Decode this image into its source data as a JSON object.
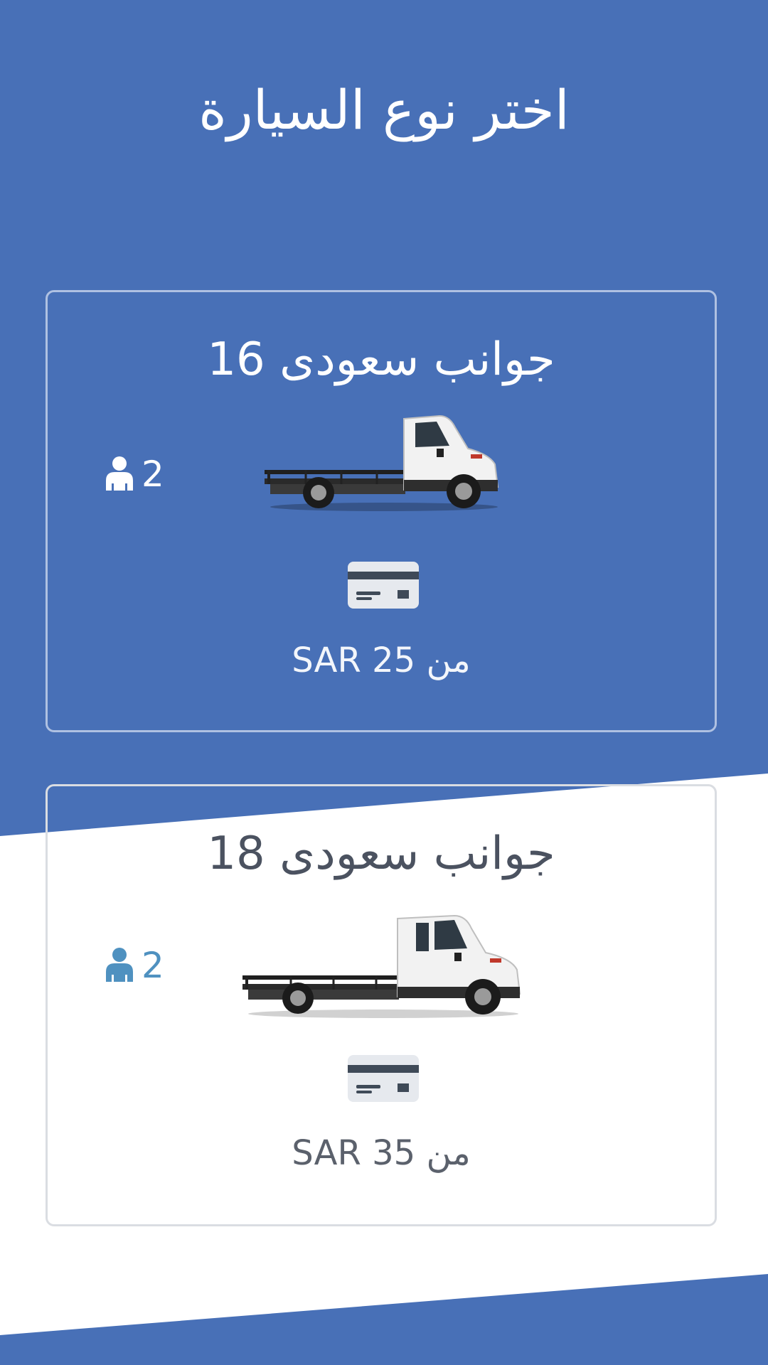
{
  "header": {
    "title": "اختر نوع السيارة"
  },
  "colors": {
    "brand_blue": "#4870b7",
    "white": "#ffffff",
    "card_border": "#d6dae0",
    "seat_icon_blue": "#4f91c0"
  },
  "vehicles": [
    {
      "name": "جوانب سعودى 16",
      "seats": "2",
      "price_prefix": "من",
      "price": "SAR 25",
      "seat_icon": "person-icon",
      "payment_icon": "credit-card-icon",
      "image": "flatbed-truck-image"
    },
    {
      "name": "جوانب سعودى 18",
      "seats": "2",
      "price_prefix": "من",
      "price": "SAR 35",
      "seat_icon": "person-icon",
      "payment_icon": "credit-card-icon",
      "image": "flatbed-truck-extended-cab-image"
    }
  ]
}
